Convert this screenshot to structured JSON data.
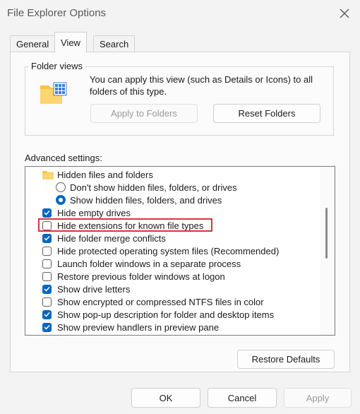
{
  "window": {
    "title": "File Explorer Options"
  },
  "tabs": [
    {
      "label": "General"
    },
    {
      "label": "View"
    },
    {
      "label": "Search"
    }
  ],
  "folder_views": {
    "title": "Folder views",
    "description": "You can apply this view (such as Details or Icons) to all folders of this type.",
    "apply_button": "Apply to Folders",
    "reset_button": "Reset Folders"
  },
  "advanced": {
    "label": "Advanced settings:",
    "items": [
      {
        "type": "folder",
        "label": "Hidden files and folders"
      },
      {
        "type": "radio",
        "label": "Don't show hidden files, folders, or drives",
        "checked": false
      },
      {
        "type": "radio",
        "label": "Show hidden files, folders, and drives",
        "checked": true
      },
      {
        "type": "checkbox",
        "label": "Hide empty drives",
        "checked": true
      },
      {
        "type": "checkbox",
        "label": "Hide extensions for known file types",
        "checked": false
      },
      {
        "type": "checkbox",
        "label": "Hide folder merge conflicts",
        "checked": true
      },
      {
        "type": "checkbox",
        "label": "Hide protected operating system files (Recommended)",
        "checked": false
      },
      {
        "type": "checkbox",
        "label": "Launch folder windows in a separate process",
        "checked": false
      },
      {
        "type": "checkbox",
        "label": "Restore previous folder windows at logon",
        "checked": false
      },
      {
        "type": "checkbox",
        "label": "Show drive letters",
        "checked": true
      },
      {
        "type": "checkbox",
        "label": "Show encrypted or compressed NTFS files in color",
        "checked": false
      },
      {
        "type": "checkbox",
        "label": "Show pop-up description for folder and desktop items",
        "checked": true
      },
      {
        "type": "checkbox",
        "label": "Show preview handlers in preview pane",
        "checked": true
      }
    ],
    "restore_defaults": "Restore Defaults"
  },
  "footer": {
    "ok": "OK",
    "cancel": "Cancel",
    "apply": "Apply"
  },
  "colors": {
    "accent": "#0067c0",
    "highlight_box": "#d2373c",
    "folder": "#f6c343"
  }
}
